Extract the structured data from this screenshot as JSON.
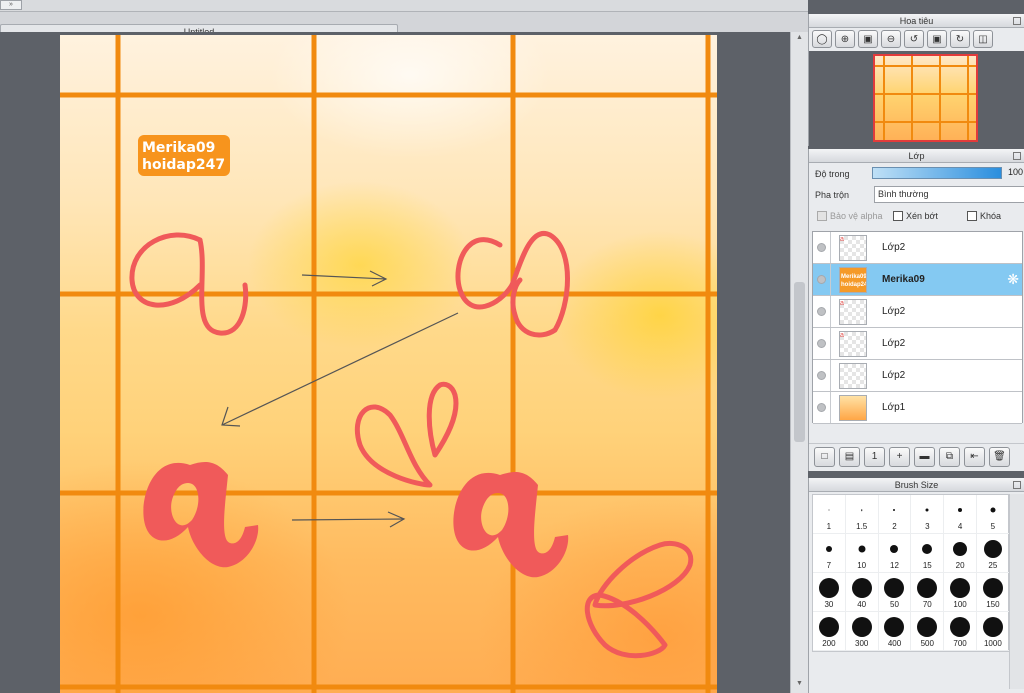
{
  "document": {
    "tab_title": "Untitled"
  },
  "canvas": {
    "watermark_line1": "Merika09",
    "watermark_line2": "hoidap247",
    "accent_grid_color": "#f18a0f",
    "stroke_color": "#f05a5a"
  },
  "navigator": {
    "title": "Hoa tiêu",
    "tools": [
      "zoom-actual-icon",
      "zoom-in-icon",
      "fit-screen-icon",
      "zoom-out-icon",
      "rotate-left-icon",
      "fit-rotate-icon",
      "rotate-right-icon",
      "flip-icon"
    ]
  },
  "layers": {
    "title": "Lớp",
    "opacity_label": "Độ trong",
    "opacity_value": "100",
    "blend_label": "Pha trộn",
    "blend_value": "Bình thường",
    "protect_alpha": "Bảo vệ alpha",
    "clipping": "Xén bớt",
    "lock": "Khóa",
    "items": [
      {
        "name": "Lớp2",
        "thumb": "a"
      },
      {
        "name": "Merika09",
        "thumb": "Merika09 hoidap247",
        "active": true
      },
      {
        "name": "Lớp2",
        "thumb": "a"
      },
      {
        "name": "Lớp2",
        "thumb": "a"
      },
      {
        "name": "Lớp2",
        "thumb": ""
      },
      {
        "name": "Lớp1",
        "thumb": ""
      }
    ],
    "tools": [
      "new-layer-icon",
      "new-raster-icon",
      "new-1bit-icon",
      "add-icon",
      "folder-icon",
      "duplicate-icon",
      "merge-icon",
      "delete-icon"
    ]
  },
  "brush": {
    "title": "Brush Size",
    "sizes": [
      "1",
      "1.5",
      "2",
      "3",
      "4",
      "5",
      "7",
      "10",
      "12",
      "15",
      "20",
      "25",
      "30",
      "40",
      "50",
      "70",
      "100",
      "150",
      "200",
      "300",
      "400",
      "500",
      "700",
      "1000"
    ]
  }
}
